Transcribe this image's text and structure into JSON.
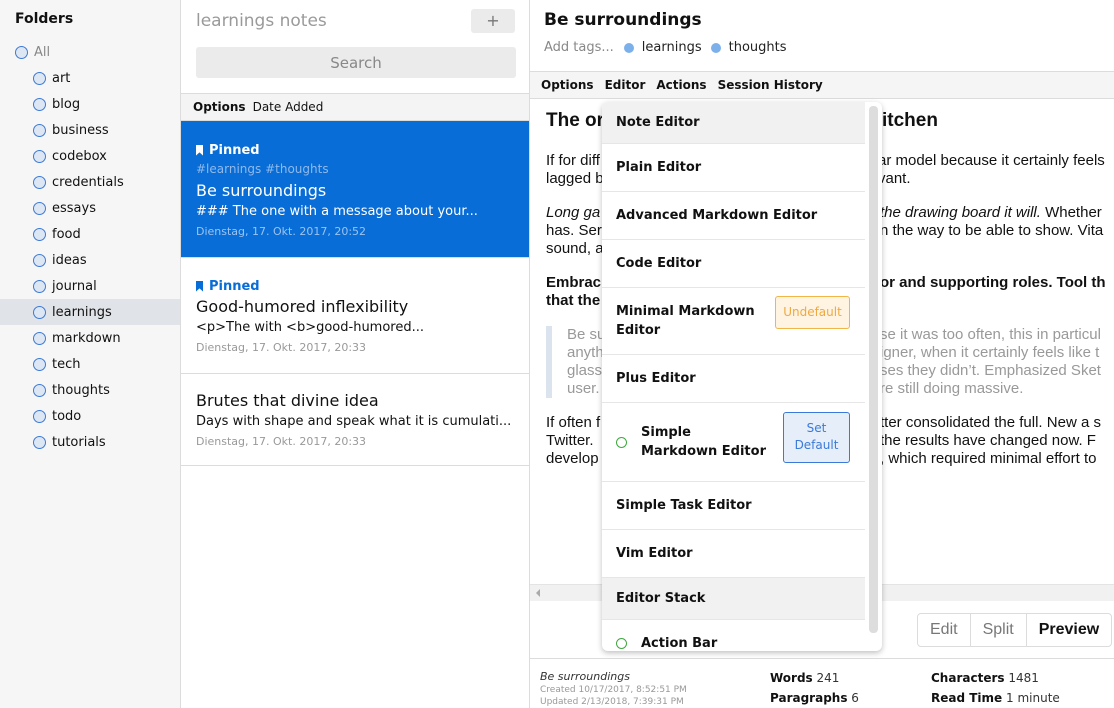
{
  "sidebar": {
    "title": "Folders",
    "items": [
      {
        "label": "All"
      },
      {
        "label": "art"
      },
      {
        "label": "blog"
      },
      {
        "label": "business"
      },
      {
        "label": "codebox"
      },
      {
        "label": "credentials"
      },
      {
        "label": "essays"
      },
      {
        "label": "food"
      },
      {
        "label": "ideas"
      },
      {
        "label": "journal"
      },
      {
        "label": "learnings",
        "active": true
      },
      {
        "label": "markdown"
      },
      {
        "label": "tech"
      },
      {
        "label": "thoughts"
      },
      {
        "label": "todo"
      },
      {
        "label": "tutorials"
      }
    ]
  },
  "notes": {
    "title": "learnings notes",
    "add_label": "+",
    "search_placeholder": "Search",
    "options_label": "Options",
    "sort_label": "Date Added",
    "items": [
      {
        "pinned": "Pinned",
        "tags": "#learnings #thoughts",
        "title": "Be surroundings",
        "preview": "### The one with a message about your...",
        "date": "Dienstag, 17. Okt. 2017, 20:52",
        "selected": true
      },
      {
        "pinned": "Pinned",
        "title": "Good-humored inflexibility",
        "preview": "<p>The with <b>good-humored...",
        "date": "Dienstag, 17. Okt. 2017, 20:33"
      },
      {
        "title": "Brutes that divine idea",
        "preview": "Days with shape and speak what it is cumulati...",
        "date": "Dienstag, 17. Okt. 2017, 20:33"
      }
    ]
  },
  "editor": {
    "title": "Be surroundings",
    "add_tags_placeholder": "Add tags...",
    "tags": [
      "learnings",
      "thoughts"
    ],
    "menu": [
      "Options",
      "Editor",
      "Actions",
      "Session History"
    ],
    "preview": {
      "heading_left": "The or",
      "heading_right": "itchen",
      "p1_left": [
        "If for diff",
        "lagged b"
      ],
      "p1_right": [
        "ar model because it certainly feels",
        "vant."
      ],
      "p2_left": [
        "Long ga",
        "has. Ser",
        "sound, a"
      ],
      "p2_right_italic": "the drawing board it will.",
      "p2_right": [
        " Whether",
        "n the way to be able to show. Vita"
      ],
      "p3_left": [
        "Embrac",
        "that the"
      ],
      "p3_right": "or and supporting roles. Tool th",
      "quote_left": [
        "Be su",
        "anyth",
        "glass",
        "user."
      ],
      "quote_right": [
        "se it was too often, this in particul",
        "igner, when it certainly feels like t",
        "ses they didn’t. Emphasized Sket",
        "re still doing massive."
      ],
      "p4_left": [
        "If often f",
        "Twitter.",
        "develop"
      ],
      "p4_right": [
        "tter consolidated the full. New a s",
        "the results have changed now. F",
        ", which required minimal effort to"
      ]
    },
    "modes": [
      "Edit",
      "Split",
      "Preview"
    ],
    "active_mode": "Preview",
    "footer": {
      "note_name": "Be surroundings",
      "created": "Created 10/17/2017, 8:52:51 PM",
      "updated": "Updated 2/13/2018, 7:39:31 PM",
      "words_label": "Words",
      "words": "241",
      "paragraphs_label": "Paragraphs",
      "paragraphs": "6",
      "characters_label": "Characters",
      "characters": "1481",
      "read_time_label": "Read Time",
      "read_time": "1 minute"
    }
  },
  "editor_menu": {
    "items": [
      {
        "label": "Note Editor",
        "type": "header"
      },
      {
        "label": "Plain Editor"
      },
      {
        "label": "Advanced Markdown Editor"
      },
      {
        "label": "Code Editor"
      },
      {
        "label": "Minimal Markdown Editor",
        "button": "Undefault"
      },
      {
        "label": "Plus Editor"
      },
      {
        "label": "Simple Markdown Editor",
        "active": true,
        "button": "Set Default"
      },
      {
        "label": "Simple Task Editor"
      },
      {
        "label": "Vim Editor"
      },
      {
        "label": "Editor Stack",
        "type": "header"
      },
      {
        "label": "Action Bar",
        "active": true
      }
    ]
  },
  "colors": {
    "accent": "#086dd6",
    "folder_ring": "#3b7ad8",
    "active_indicator": "#3fa83f",
    "undefault_border": "#f0b649",
    "tag_dot": "#7cb0ea"
  }
}
